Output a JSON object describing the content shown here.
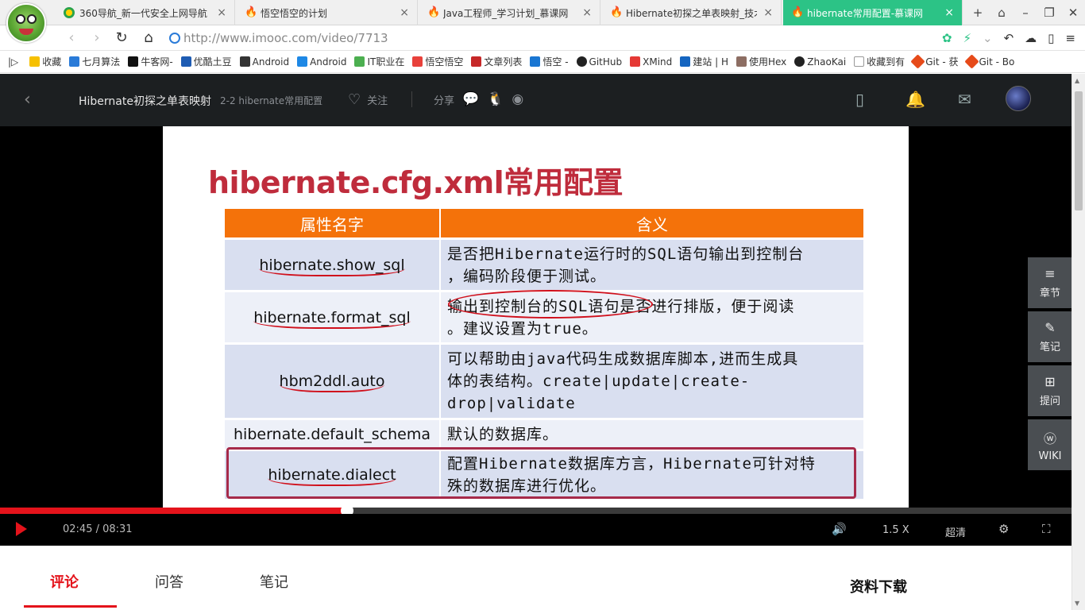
{
  "browser": {
    "tabs": [
      {
        "title": "360导航_新一代安全上网导航",
        "icon": "360-logo-icon",
        "active": false
      },
      {
        "title": "悟空悟空的计划",
        "icon": "imooc-flame-icon",
        "active": false
      },
      {
        "title": "Java工程师_学习计划_慕课网",
        "icon": "imooc-flame-icon",
        "active": false
      },
      {
        "title": "Hibernate初探之单表映射_技术:",
        "icon": "imooc-flame-icon",
        "active": false
      },
      {
        "title": "hibernate常用配置-慕课网",
        "icon": "imooc-flame-icon",
        "active": true
      }
    ],
    "address": "http://www.imooc.com/video/7713",
    "bookmarks": [
      "收藏",
      "七月算法",
      "牛客网-",
      "优酷土豆",
      "Android",
      "Android",
      "IT职业在",
      "悟空悟空",
      "文章列表",
      "悟空 -",
      "GitHub",
      "XMind",
      "建站 | H",
      "使用Hex",
      "ZhaoKai",
      "收藏到有",
      "Git - 获",
      "Git - Bo"
    ]
  },
  "header": {
    "course": "Hibernate初探之单表映射",
    "chapter": "2-2 hibernate常用配置",
    "follow_label": "关注",
    "share_label": "分享"
  },
  "slide": {
    "title": "hibernate.cfg.xml常用配置",
    "col_name": "属性名字",
    "col_meaning": "含义",
    "rows": [
      {
        "name": "hibernate.show_sql",
        "desc1": "是否把Hibernate运行时的SQL语句输出到控制台",
        "desc2": "，编码阶段便于测试。"
      },
      {
        "name": "hibernate.format_sql",
        "desc1": "输出到控制台的SQL语句是否进行排版，便于阅读",
        "desc2": "。建议设置为true。"
      },
      {
        "name": "hbm2ddl.auto",
        "desc1": "可以帮助由java代码生成数据库脚本,进而生成具",
        "desc2": "体的表结构。create|update|create-",
        "desc3": "drop|validate"
      },
      {
        "name": "hibernate.default_schema",
        "desc1": "默认的数据库。"
      },
      {
        "name": "hibernate.dialect",
        "desc1": "配置Hibernate数据库方言，Hibernate可针对特",
        "desc2": "殊的数据库进行优化。"
      }
    ]
  },
  "player": {
    "time": "02:45 / 08:31",
    "progress": 0.32,
    "speed": "1.5 X",
    "quality": "超清"
  },
  "side_tools": [
    "章节",
    "笔记",
    "提问",
    "WIKI"
  ],
  "bottom": {
    "tabs": [
      "评论",
      "问答",
      "笔记"
    ],
    "downloads": "资料下载"
  },
  "colors": {
    "accent": "#e4131b",
    "active_tab": "#2cc386",
    "table_header": "#f4720a",
    "slide_title": "#bf2c3c"
  }
}
